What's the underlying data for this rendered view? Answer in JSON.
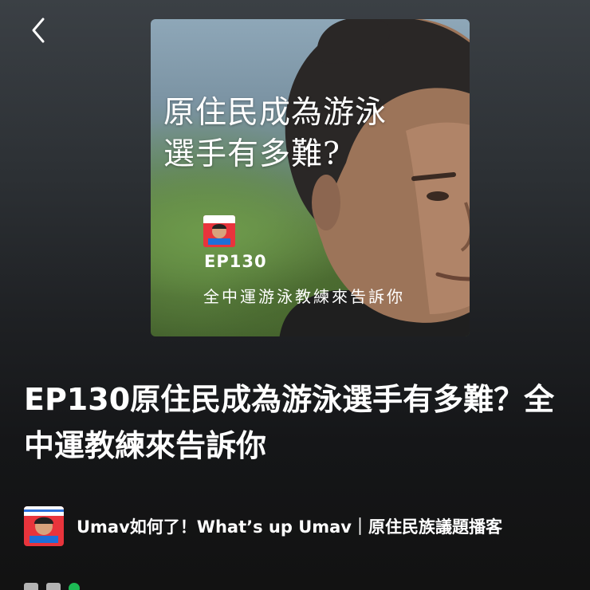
{
  "nav": {
    "back_icon": "chevron-left-icon"
  },
  "cover": {
    "title_line1": "原住民成為游泳",
    "title_line2": "選手有多難?",
    "episode_code": "EP130",
    "subtitle": "全中運游泳教練來告訴你",
    "logo_text": "Umav如何了",
    "logo_icon": "podcast-logo"
  },
  "episode": {
    "title": "EP130原住民成為游泳選手有多難？全中運教練來告訴你"
  },
  "show": {
    "name": "Umav如何了！What’s up Umav｜原住民族議題播客",
    "avatar_icon": "podcast-avatar"
  },
  "colors": {
    "background_top": "#3b4045",
    "background_bottom": "#121212",
    "text_primary": "#ffffff",
    "accent_green": "#1db954"
  }
}
